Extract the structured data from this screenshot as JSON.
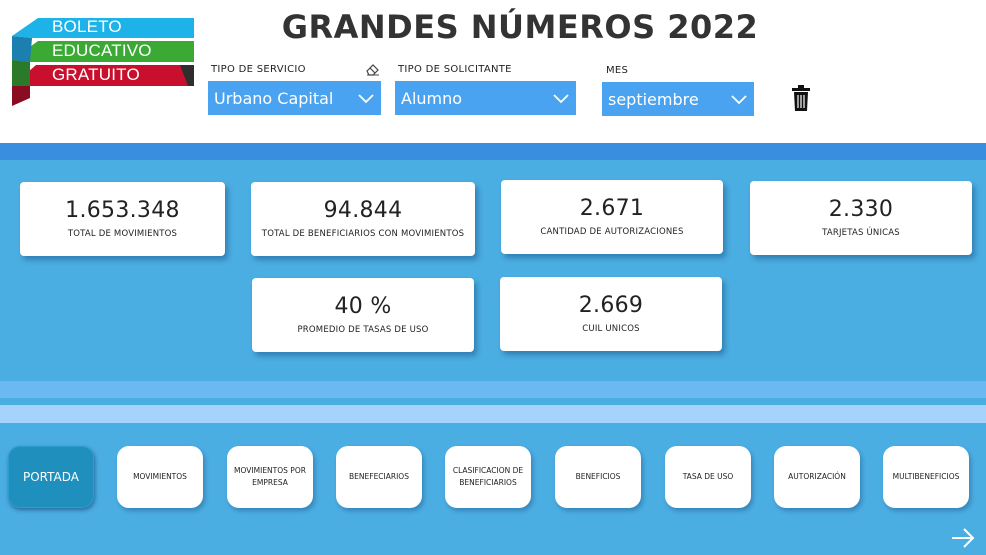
{
  "logo": {
    "line1": "BOLETO",
    "line2": "EDUCATIVO",
    "line3": "GRATUITO"
  },
  "title": "GRANDES NÚMEROS 2022",
  "filters": {
    "servicio": {
      "label": "TIPO DE SERVICIO",
      "value": "Urbano Capital"
    },
    "solicitante": {
      "label": "TIPO DE SOLICITANTE",
      "value": "Alumno"
    },
    "mes": {
      "label": "MES",
      "value": "septiembre"
    }
  },
  "kpis": [
    {
      "value": "1.653.348",
      "label": "TOTAL DE MOVIMIENTOS"
    },
    {
      "value": "94.844",
      "label": "TOTAL DE BENEFICIARIOS CON MOVIMIENTOS"
    },
    {
      "value": "2.671",
      "label": "CANTIDAD DE AUTORIZACIONES"
    },
    {
      "value": "2.330",
      "label": "TARJETAS ÚNICAS"
    },
    {
      "value": "40 %",
      "label": "PROMEDIO DE TASAS DE USO"
    },
    {
      "value": "2.669",
      "label": "CUIL UNICOS"
    }
  ],
  "nav": [
    {
      "label": "PORTADA"
    },
    {
      "label": "MOVIMIENTOS"
    },
    {
      "label": "MOVIMIENTOS POR EMPRESA"
    },
    {
      "label": "BENEFECIARIOS"
    },
    {
      "label": "CLASIFICACION DE BENEFICIARIOS"
    },
    {
      "label": "BENEFICIOS"
    },
    {
      "label": "TASA DE USO"
    },
    {
      "label": "AUTORIZACIÓN"
    },
    {
      "label": "MULTIBENEFICIOS"
    }
  ],
  "colors": {
    "brand_blue": "#1eb3e8",
    "brand_green": "#3aaa35",
    "brand_red": "#c8102e",
    "filter_bg": "#4aa3f0",
    "panel_bg": "#4baee2",
    "active_nav": "#1f8fbd"
  },
  "icons": {
    "clear_filter": "eraser-icon",
    "delete": "trash-icon",
    "next_page": "arrow-right-icon",
    "dropdown": "chevron-down-icon"
  }
}
